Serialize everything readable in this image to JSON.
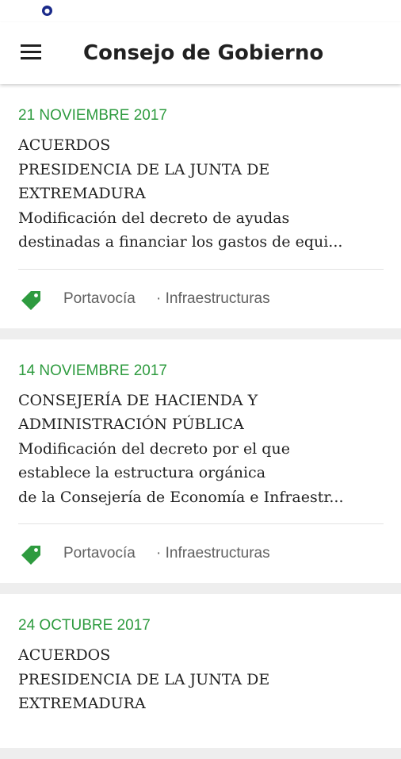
{
  "app": {
    "title": "Consejo de Gobierno",
    "accent_color": "#2e9b3f",
    "status_icon": "shield-icon"
  },
  "cards": [
    {
      "date": "21 NOVIEMBRE 2017",
      "lines": [
        "ACUERDOS",
        "PRESIDENCIA DE LA JUNTA DE",
        "EXTREMADURA",
        "Modificación del decreto de ayudas",
        "destinadas a financiar los gastos de equi..."
      ],
      "tag_icon": "tag-icon",
      "tag_primary": "Portavocía",
      "tag_secondary": "· Infraestructuras"
    },
    {
      "date": "14 NOVIEMBRE 2017",
      "lines": [
        "CONSEJERÍA DE HACIENDA Y",
        "ADMINISTRACIÓN PÚBLICA",
        "Modificación del decreto por el que",
        "establece la estructura orgánica",
        "de la Consejería de Economía e Infraestr..."
      ],
      "tag_icon": "tag-icon",
      "tag_primary": "Portavocía",
      "tag_secondary": "· Infraestructuras"
    },
    {
      "date": "24 OCTUBRE 2017",
      "lines": [
        "ACUERDOS",
        "PRESIDENCIA DE LA JUNTA DE",
        "EXTREMADURA"
      ]
    }
  ]
}
